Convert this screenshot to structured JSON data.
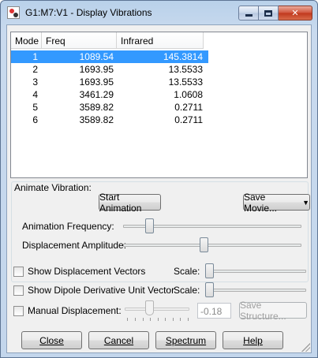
{
  "window": {
    "title": "G1:M7:V1 - Display Vibrations",
    "icon": "gaussview-molecule-icon"
  },
  "list": {
    "columns": [
      "Mode",
      "Freq",
      "Infrared"
    ],
    "rows": [
      {
        "mode": "1",
        "freq": "1089.54",
        "ir": "145.3814"
      },
      {
        "mode": "2",
        "freq": "1693.95",
        "ir": "13.5533"
      },
      {
        "mode": "3",
        "freq": "1693.95",
        "ir": "13.5533"
      },
      {
        "mode": "4",
        "freq": "3461.29",
        "ir": "1.0608"
      },
      {
        "mode": "5",
        "freq": "3589.82",
        "ir": "0.2711"
      },
      {
        "mode": "6",
        "freq": "3589.82",
        "ir": "0.2711"
      }
    ],
    "selected_row": 1
  },
  "animate": {
    "group_label": "Animate Vibration:",
    "start_button": "Start Animation",
    "save_movie_button": "Save Movie...",
    "frequency_label": "Animation Frequency:",
    "frequency_level": 0.13,
    "amplitude_label": "Displacement Amplitude:",
    "amplitude_level": 0.45
  },
  "options": {
    "show_vectors_label": "Show Displacement Vectors",
    "show_vectors_checked": false,
    "vectors_scale_label": "Scale:",
    "vectors_scale_level": 0.0,
    "show_dipole_label": "Show Dipole Derivative Unit Vector",
    "show_dipole_checked": false,
    "dipole_scale_label": "Scale:",
    "dipole_scale_level": 0.0,
    "manual_label": "Manual Displacement:",
    "manual_checked": false,
    "manual_value": "-0.18",
    "save_structure_button": "Save Structure..."
  },
  "footer": {
    "close": "Close",
    "cancel": "Cancel",
    "spectrum": "Spectrum",
    "help": "Help"
  },
  "colors": {
    "selection": "#3399ff",
    "titlebar": "#c3d6ec"
  }
}
